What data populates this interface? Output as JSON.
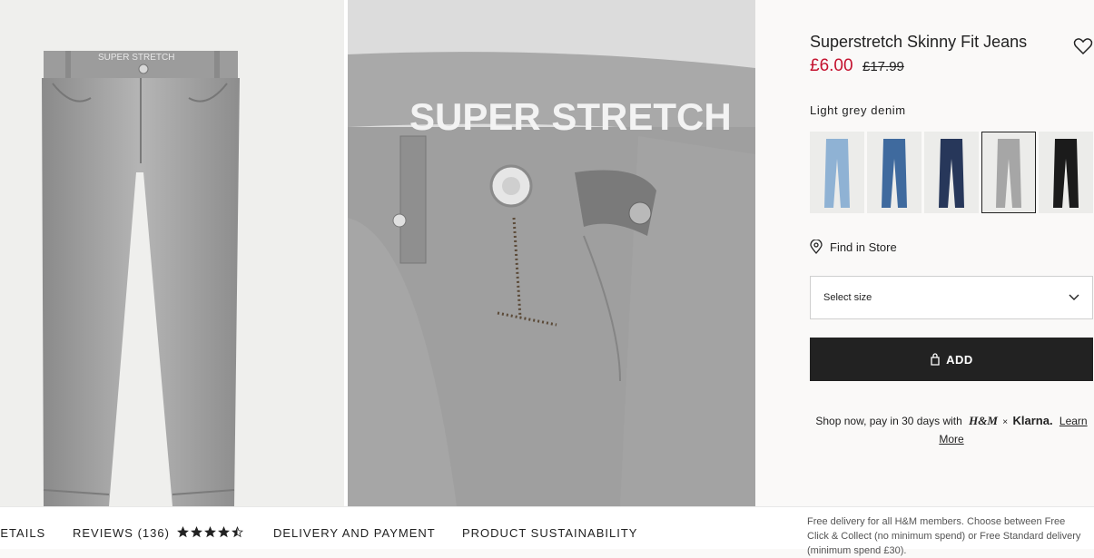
{
  "product": {
    "title": "Superstretch Skinny Fit Jeans",
    "price_current": "£6.00",
    "price_original": "£17.99",
    "color_name": "Light grey denim",
    "selected_swatch": 3
  },
  "gallery": {
    "closeup_text": "SUPER STRETCH",
    "waistband_text": "SUPER STRETCH"
  },
  "swatches": [
    {
      "name": "light-blue-denim",
      "color": "#8fb2d4"
    },
    {
      "name": "blue-denim",
      "color": "#3f6a9e"
    },
    {
      "name": "dark-blue-denim",
      "color": "#27375a"
    },
    {
      "name": "light-grey-denim",
      "color": "#a6a6a6"
    },
    {
      "name": "black-denim",
      "color": "#1b1b1b"
    }
  ],
  "find_in_store": "Find in Store",
  "size_select": {
    "label": "Select size"
  },
  "add_button": {
    "label": "ADD"
  },
  "klarna": {
    "text": "Shop now, pay in 30 days with",
    "brand_hm": "H&M",
    "times": "×",
    "brand_klarna": "Klarna.",
    "link": "Learn More"
  },
  "tabs": {
    "details": "DETAILS",
    "reviews": "REVIEWS (136)",
    "rating": 4.5,
    "delivery": "DELIVERY AND PAYMENT",
    "sustainability": "PRODUCT SUSTAINABILITY"
  },
  "delivery_note": "Free delivery for all H&M members. Choose between Free Click & Collect (no minimum spend) or Free Standard delivery (minimum spend £30).",
  "colors": {
    "price_red": "#c4122f",
    "button_black": "#222222",
    "panel_bg": "#faf9f8"
  }
}
